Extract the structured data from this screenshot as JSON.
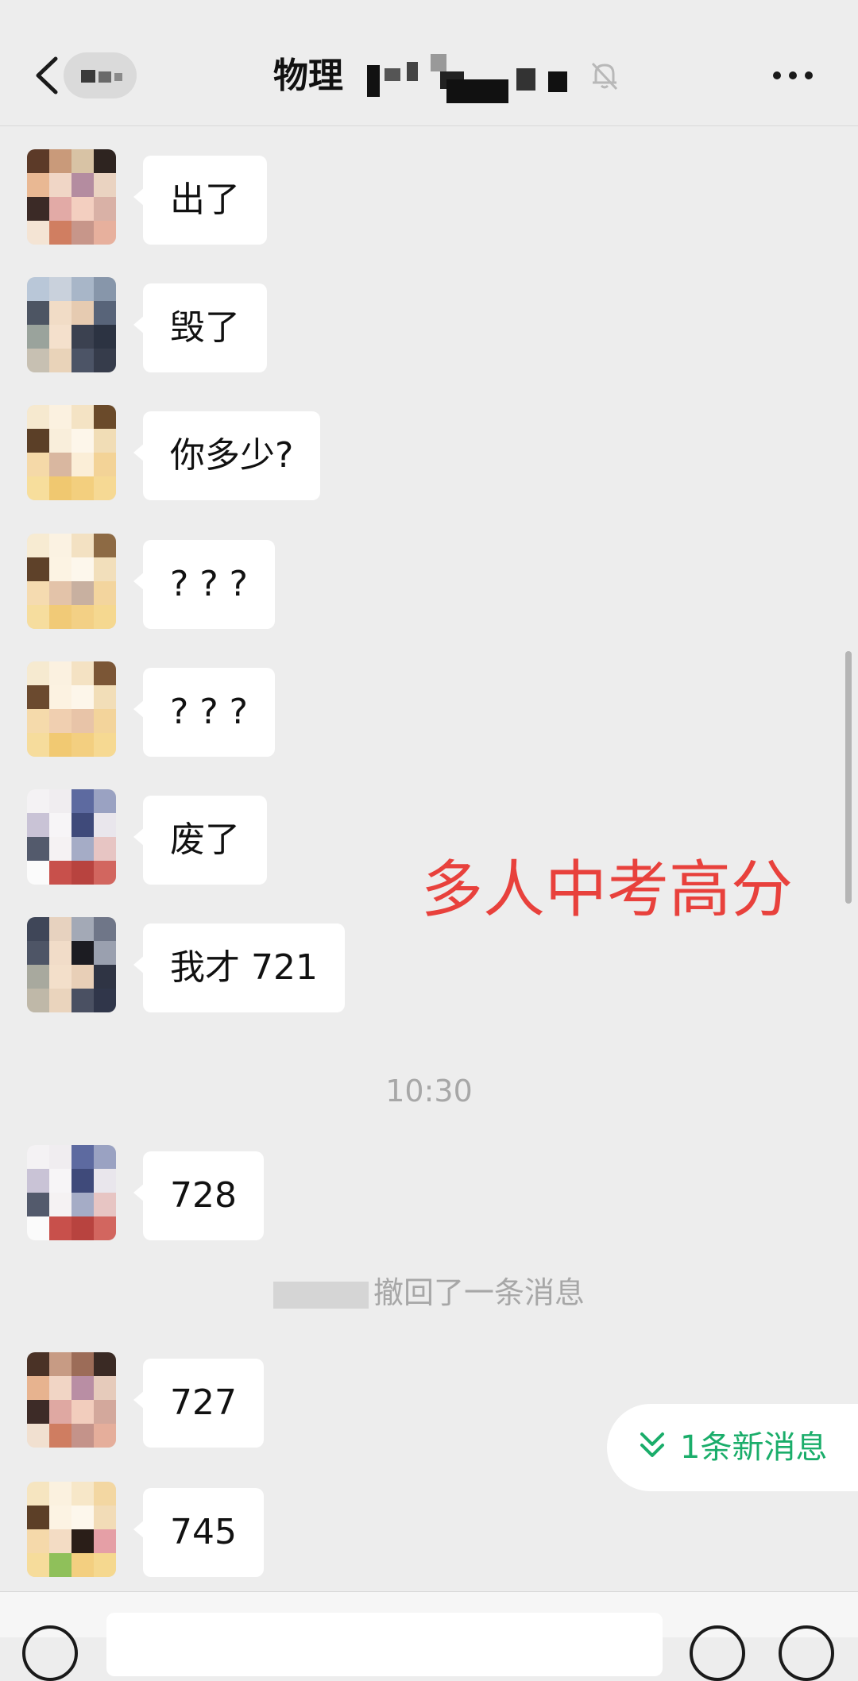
{
  "header": {
    "title": "物理",
    "back_icon": "chevron-left-icon",
    "mute_icon": "bell-off-icon",
    "more_icon": "more-dots-icon"
  },
  "messages": [
    {
      "text": "出了"
    },
    {
      "text": "毁了"
    },
    {
      "text": "你多少?"
    },
    {
      "text": "? ? ?"
    },
    {
      "text": "? ? ?"
    },
    {
      "text": "废了"
    },
    {
      "text": "我才 721"
    },
    {
      "text": "728"
    },
    {
      "text": "727"
    },
    {
      "text": "745"
    }
  ],
  "timestamp": "10:30",
  "recall_notice": "撤回了一条消息",
  "overlay_caption": "多人中考高分",
  "new_message_button": {
    "label": "1条新消息",
    "icon": "double-chevron-down-icon",
    "color": "#1aad6a"
  },
  "colors": {
    "background": "#ededed",
    "bubble": "#ffffff",
    "caption": "#e8413c",
    "timestamp": "#a7a7a7"
  }
}
